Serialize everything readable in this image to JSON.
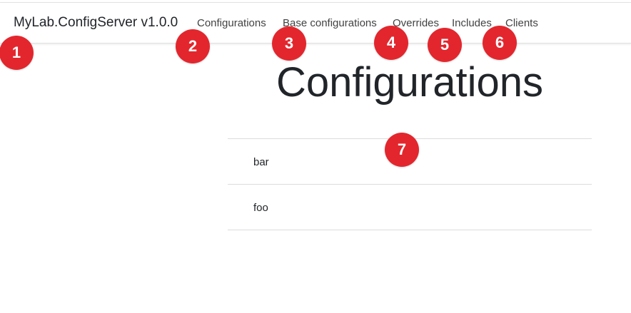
{
  "navbar": {
    "brand": "MyLab.ConfigServer v1.0.0",
    "links": [
      "Configurations",
      "Base configurations",
      "Overrides",
      "Includes",
      "Clients"
    ]
  },
  "main": {
    "title": "Configurations",
    "items": [
      "bar",
      "foo"
    ]
  },
  "annotations": [
    "1",
    "2",
    "3",
    "4",
    "5",
    "6",
    "7"
  ],
  "colors": {
    "marker": "#e3262d",
    "divider": "#dcdcdc"
  }
}
